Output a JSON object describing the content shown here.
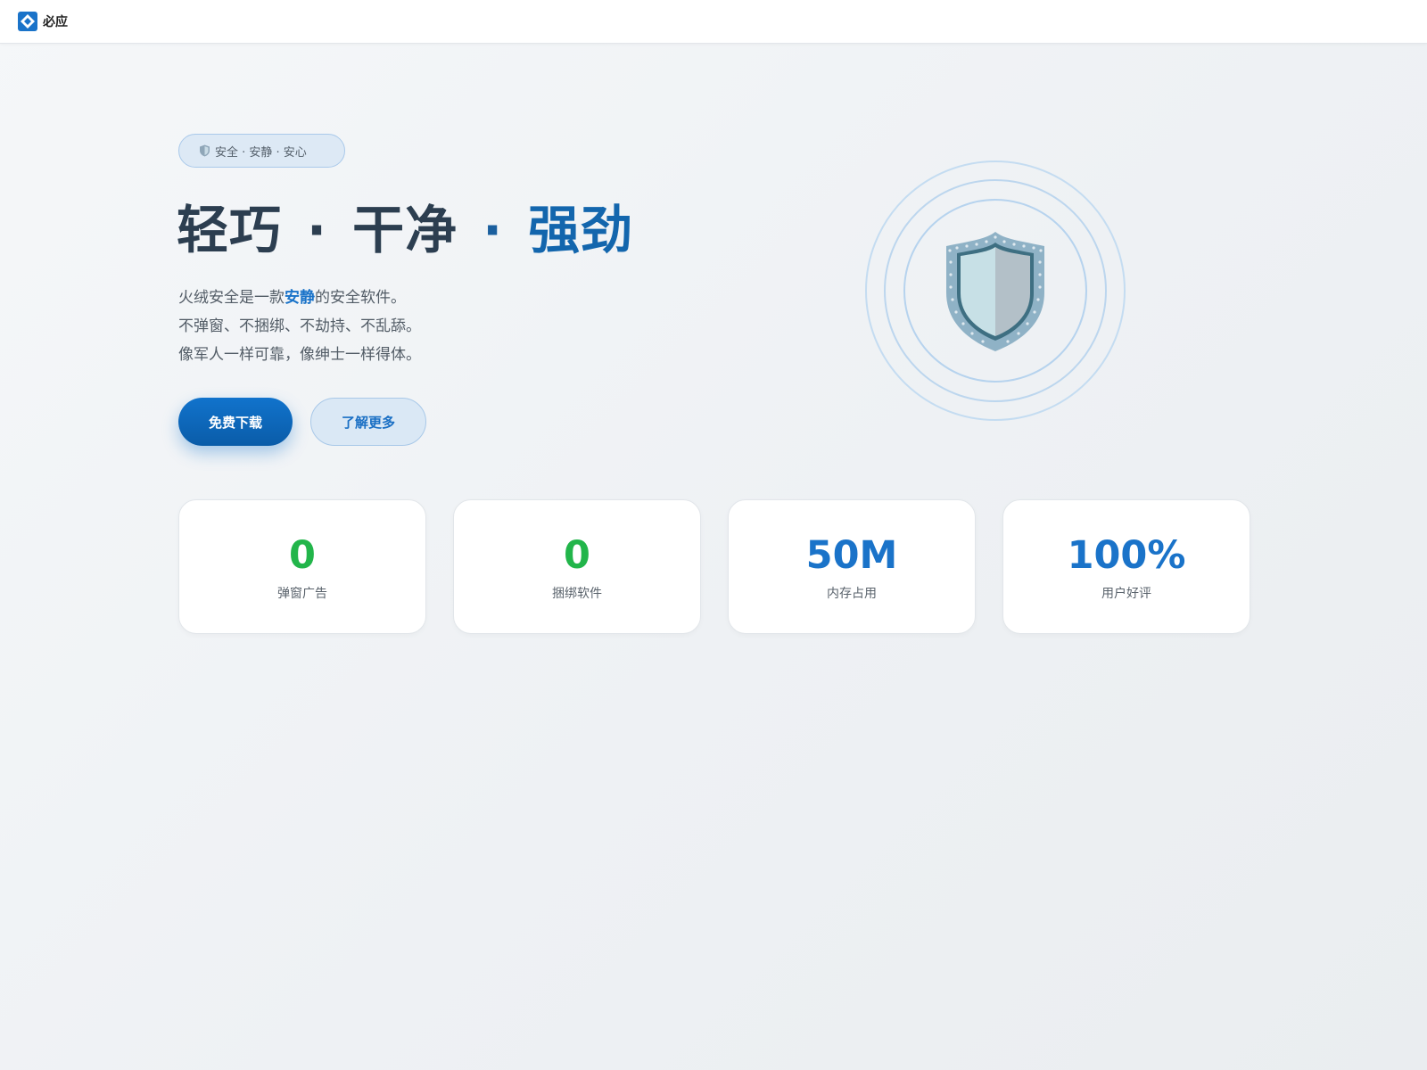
{
  "header": {
    "brand_name": "必应",
    "logo_icon": "bing-logo-icon"
  },
  "hero": {
    "badge_icon": "shield-icon",
    "badge_text": "安全 · 安静 · 安心",
    "headline": {
      "part1": "轻巧",
      "sep1": "·",
      "part2": "干净",
      "sep2": "·",
      "part3": "强劲"
    },
    "description": {
      "line1_before": "火绒安全是一款",
      "line1_emphasis": "安静",
      "line1_after": "的安全软件。",
      "line2": "不弹窗、不捆绑、不劫持、不乱舔。",
      "line3": "像军人一样可靠，像绅士一样得体。"
    },
    "primary_button": "免费下载",
    "secondary_button": "了解更多",
    "illustration_icon": "shield-icon"
  },
  "stats": [
    {
      "value": "0",
      "label": "弹窗广告",
      "color": "#22b54a"
    },
    {
      "value": "0",
      "label": "捆绑软件",
      "color": "#22b54a"
    },
    {
      "value": "50M",
      "label": "内存占用",
      "color": "#1a73c9"
    },
    {
      "value": "100%",
      "label": "用户好评",
      "color": "#1a73c9"
    }
  ],
  "colors": {
    "accent": "#1a73c9",
    "primary_button": "#0f6cc2",
    "headline_dark": "#2c3e50",
    "headline_blue": "#1366ad",
    "success": "#22b54a"
  }
}
